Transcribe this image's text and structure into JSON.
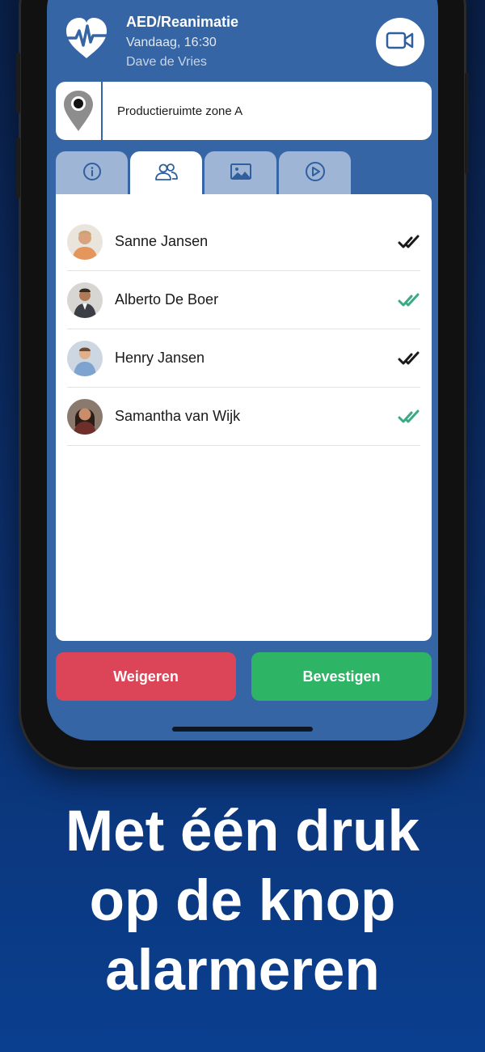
{
  "header": {
    "title": "AED/Reanimatie",
    "datetime": "Vandaag, 16:30",
    "user": "Dave  de Vries",
    "icon": "heart-pulse-icon",
    "video_icon": "video-camera-icon"
  },
  "location": {
    "text": "Productieruimte zone A",
    "icon": "map-pin-icon"
  },
  "tabs": [
    {
      "icon": "info-icon",
      "active": false
    },
    {
      "icon": "people-icon",
      "active": true
    },
    {
      "icon": "image-icon",
      "active": false
    },
    {
      "icon": "play-icon",
      "active": false
    }
  ],
  "contacts": [
    {
      "name": "Sanne  Jansen",
      "status_color": "#1a1a1a"
    },
    {
      "name": "Alberto De Boer",
      "status_color": "#3aaa86"
    },
    {
      "name": "Henry  Jansen",
      "status_color": "#1a1a1a"
    },
    {
      "name": "Samantha  van Wijk",
      "status_color": "#3aaa86"
    }
  ],
  "buttons": {
    "decline": "Weigeren",
    "confirm": "Bevestigen"
  },
  "slogan": {
    "line1": "Met één druk",
    "line2": "op de knop",
    "line3": "alarmeren"
  },
  "colors": {
    "screen_bg": "#3565a5",
    "decline": "#dc4558",
    "confirm": "#2db465"
  }
}
